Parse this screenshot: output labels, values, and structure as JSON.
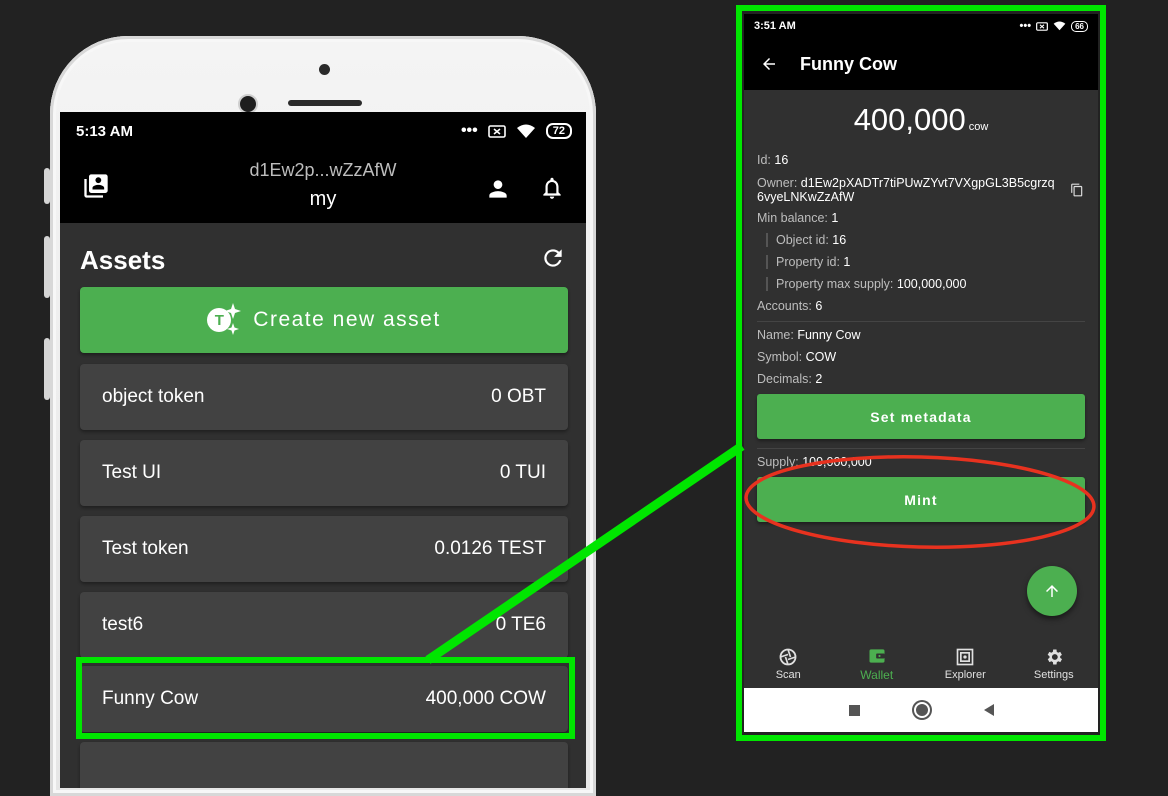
{
  "left": {
    "status": {
      "time": "5:13 AM",
      "battery": "72"
    },
    "appbar": {
      "address": "d1Ew2p...wZzAfW",
      "wallet_name": "my"
    },
    "assets_title": "Assets",
    "create_button_label": "Create new asset",
    "create_button_badge": "T",
    "assets": [
      {
        "name": "object token",
        "balance": "0 OBT"
      },
      {
        "name": "Test UI",
        "balance": "0 TUI"
      },
      {
        "name": "Test token",
        "balance": "0.0126 TEST"
      },
      {
        "name": "test6",
        "balance": "0 TE6"
      },
      {
        "name": "Funny Cow",
        "balance": "400,000 COW"
      }
    ]
  },
  "right": {
    "status": {
      "time": "3:51 AM",
      "battery": "66"
    },
    "title": "Funny Cow",
    "supply_value": "400,000",
    "supply_unit": "cow",
    "details": {
      "id_label": "Id:",
      "id": "16",
      "owner_label": "Owner:",
      "owner_line1": "d1Ew2pXADTr7tiPUwZYvt7VXgpGL3B5cgrzq",
      "owner_line2": "6vyeLNKwZzAfW",
      "min_balance_label": "Min balance:",
      "min_balance": "1",
      "object_id_label": "Object id:",
      "object_id": "16",
      "property_id_label": "Property id:",
      "property_id": "1",
      "max_supply_label": "Property max supply:",
      "max_supply": "100,000,000",
      "accounts_label": "Accounts:",
      "accounts": "6",
      "name_label": "Name:",
      "name": "Funny Cow",
      "symbol_label": "Symbol:",
      "symbol": "COW",
      "decimals_label": "Decimals:",
      "decimals": "2",
      "supply_label": "Supply:",
      "supply": "100,000,000"
    },
    "set_metadata_label": "Set metadata",
    "mint_label": "Mint",
    "nav": [
      {
        "label": "Scan",
        "icon": "camera-shutter-icon"
      },
      {
        "label": "Wallet",
        "icon": "wallet-icon",
        "active": true
      },
      {
        "label": "Explorer",
        "icon": "explorer-icon"
      },
      {
        "label": "Settings",
        "icon": "gear-icon"
      }
    ]
  },
  "colors": {
    "accent": "#4caf50",
    "highlight": "#00e600",
    "annotation": "#e8321f",
    "background": "#222222"
  }
}
